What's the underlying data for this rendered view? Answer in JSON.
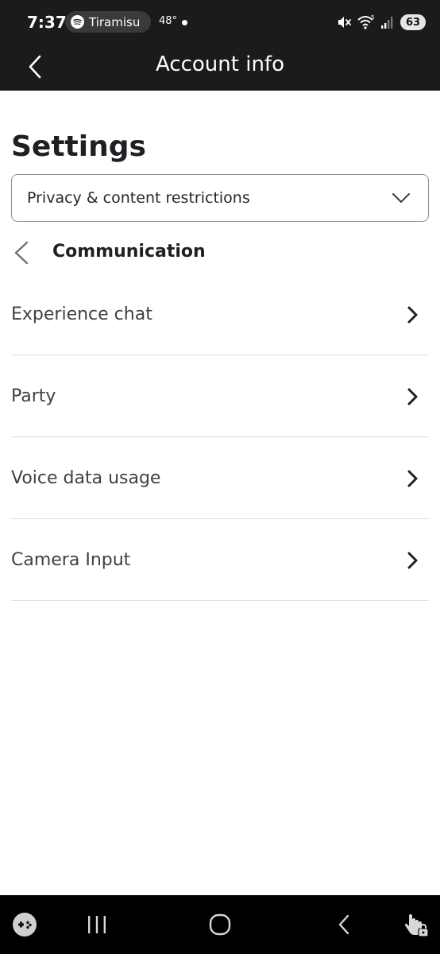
{
  "status_bar": {
    "time": "7:37",
    "spotify_label": "Tiramisu",
    "temperature": "48°",
    "battery": "63",
    "icons": [
      "spotify-icon",
      "mute-icon",
      "wifi-icon",
      "signal-icon",
      "battery-icon"
    ]
  },
  "app_bar": {
    "title": "Account info",
    "back_icon": "chevron-left-icon"
  },
  "page": {
    "title": "Settings",
    "dropdown": {
      "selected": "Privacy & content restrictions",
      "icon": "chevron-down-icon"
    },
    "section": {
      "title": "Communication",
      "back_icon": "chevron-left-icon"
    },
    "items": [
      {
        "label": "Experience chat"
      },
      {
        "label": "Party"
      },
      {
        "label": "Voice data usage"
      },
      {
        "label": "Camera Input"
      }
    ]
  },
  "nav_bar": {
    "icons": [
      "game-launcher-icon",
      "recent-apps-icon",
      "home-icon",
      "back-icon",
      "touch-lock-icon"
    ]
  },
  "colors": {
    "topbar_bg": "#1b1b1c",
    "text_primary": "#1f2023",
    "text_secondary": "#3e4148",
    "divider": "#dcdde0",
    "navbar_bg": "#000000"
  }
}
